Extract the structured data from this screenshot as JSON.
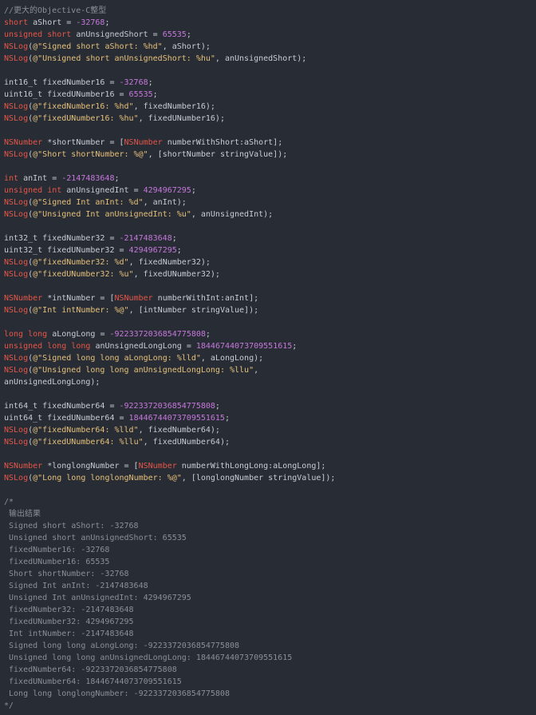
{
  "editor": {
    "colors": {
      "background": "#282c34",
      "keyword": "#e45649",
      "number": "#c678dd",
      "string": "#e5c07b",
      "comment": "#8a8f98",
      "plain": "#c8ccd4"
    },
    "lines": [
      [
        {
          "t": "comment",
          "s": "//更大的Objective-C整型"
        }
      ],
      [
        {
          "t": "keyword",
          "s": "short"
        },
        {
          "t": "plain",
          "s": " aShort = "
        },
        {
          "t": "number",
          "s": "-32768"
        },
        {
          "t": "plain",
          "s": ";"
        }
      ],
      [
        {
          "t": "keyword",
          "s": "unsigned"
        },
        {
          "t": "plain",
          "s": " "
        },
        {
          "t": "keyword",
          "s": "short"
        },
        {
          "t": "plain",
          "s": " anUnsignedShort = "
        },
        {
          "t": "number",
          "s": "65535"
        },
        {
          "t": "plain",
          "s": ";"
        }
      ],
      [
        {
          "t": "func",
          "s": "NSLog"
        },
        {
          "t": "plain",
          "s": "("
        },
        {
          "t": "string",
          "s": "@\"Signed short aShort: %hd\""
        },
        {
          "t": "plain",
          "s": ", aShort);"
        }
      ],
      [
        {
          "t": "func",
          "s": "NSLog"
        },
        {
          "t": "plain",
          "s": "("
        },
        {
          "t": "string",
          "s": "@\"Unsigned short anUnsignedShort: %hu\""
        },
        {
          "t": "plain",
          "s": ", anUnsignedShort);"
        }
      ],
      [],
      [
        {
          "t": "plain",
          "s": "int16_t fixedNumber16 = "
        },
        {
          "t": "number",
          "s": "-32768"
        },
        {
          "t": "plain",
          "s": ";"
        }
      ],
      [
        {
          "t": "plain",
          "s": "uint16_t fixedUNumber16 = "
        },
        {
          "t": "number",
          "s": "65535"
        },
        {
          "t": "plain",
          "s": ";"
        }
      ],
      [
        {
          "t": "func",
          "s": "NSLog"
        },
        {
          "t": "plain",
          "s": "("
        },
        {
          "t": "string",
          "s": "@\"fixedNumber16: %hd\""
        },
        {
          "t": "plain",
          "s": ", fixedNumber16);"
        }
      ],
      [
        {
          "t": "func",
          "s": "NSLog"
        },
        {
          "t": "plain",
          "s": "("
        },
        {
          "t": "string",
          "s": "@\"fixedUNumber16: %hu\""
        },
        {
          "t": "plain",
          "s": ", fixedUNumber16);"
        }
      ],
      [],
      [
        {
          "t": "type",
          "s": "NSNumber"
        },
        {
          "t": "plain",
          "s": " *shortNumber = ["
        },
        {
          "t": "type",
          "s": "NSNumber"
        },
        {
          "t": "plain",
          "s": " numberWithShort:aShort];"
        }
      ],
      [
        {
          "t": "func",
          "s": "NSLog"
        },
        {
          "t": "plain",
          "s": "("
        },
        {
          "t": "string",
          "s": "@\"Short shortNumber: %@\""
        },
        {
          "t": "plain",
          "s": ", [shortNumber stringValue]);"
        }
      ],
      [],
      [
        {
          "t": "keyword",
          "s": "int"
        },
        {
          "t": "plain",
          "s": " anInt = "
        },
        {
          "t": "number",
          "s": "-2147483648"
        },
        {
          "t": "plain",
          "s": ";"
        }
      ],
      [
        {
          "t": "keyword",
          "s": "unsigned"
        },
        {
          "t": "plain",
          "s": " "
        },
        {
          "t": "keyword",
          "s": "int"
        },
        {
          "t": "plain",
          "s": " anUnsignedInt = "
        },
        {
          "t": "number",
          "s": "4294967295"
        },
        {
          "t": "plain",
          "s": ";"
        }
      ],
      [
        {
          "t": "func",
          "s": "NSLog"
        },
        {
          "t": "plain",
          "s": "("
        },
        {
          "t": "string",
          "s": "@\"Signed Int anInt: %d\""
        },
        {
          "t": "plain",
          "s": ", anInt);"
        }
      ],
      [
        {
          "t": "func",
          "s": "NSLog"
        },
        {
          "t": "plain",
          "s": "("
        },
        {
          "t": "string",
          "s": "@\"Unsigned Int anUnsignedInt: %u\""
        },
        {
          "t": "plain",
          "s": ", anUnsignedInt);"
        }
      ],
      [],
      [
        {
          "t": "plain",
          "s": "int32_t fixedNumber32 = "
        },
        {
          "t": "number",
          "s": "-2147483648"
        },
        {
          "t": "plain",
          "s": ";"
        }
      ],
      [
        {
          "t": "plain",
          "s": "uint32_t fixedUNumber32 = "
        },
        {
          "t": "number",
          "s": "4294967295"
        },
        {
          "t": "plain",
          "s": ";"
        }
      ],
      [
        {
          "t": "func",
          "s": "NSLog"
        },
        {
          "t": "plain",
          "s": "("
        },
        {
          "t": "string",
          "s": "@\"fixedNumber32: %d\""
        },
        {
          "t": "plain",
          "s": ", fixedNumber32);"
        }
      ],
      [
        {
          "t": "func",
          "s": "NSLog"
        },
        {
          "t": "plain",
          "s": "("
        },
        {
          "t": "string",
          "s": "@\"fixedUNumber32: %u\""
        },
        {
          "t": "plain",
          "s": ", fixedUNumber32);"
        }
      ],
      [],
      [
        {
          "t": "type",
          "s": "NSNumber"
        },
        {
          "t": "plain",
          "s": " *intNumber = ["
        },
        {
          "t": "type",
          "s": "NSNumber"
        },
        {
          "t": "plain",
          "s": " numberWithInt:anInt];"
        }
      ],
      [
        {
          "t": "func",
          "s": "NSLog"
        },
        {
          "t": "plain",
          "s": "("
        },
        {
          "t": "string",
          "s": "@\"Int intNumber: %@\""
        },
        {
          "t": "plain",
          "s": ", [intNumber stringValue]);"
        }
      ],
      [],
      [
        {
          "t": "keyword",
          "s": "long"
        },
        {
          "t": "plain",
          "s": " "
        },
        {
          "t": "keyword",
          "s": "long"
        },
        {
          "t": "plain",
          "s": " aLongLong = "
        },
        {
          "t": "number",
          "s": "-9223372036854775808"
        },
        {
          "t": "plain",
          "s": ";"
        }
      ],
      [
        {
          "t": "keyword",
          "s": "unsigned"
        },
        {
          "t": "plain",
          "s": " "
        },
        {
          "t": "keyword",
          "s": "long"
        },
        {
          "t": "plain",
          "s": " "
        },
        {
          "t": "keyword",
          "s": "long"
        },
        {
          "t": "plain",
          "s": " anUnsignedLongLong = "
        },
        {
          "t": "number",
          "s": "18446744073709551615"
        },
        {
          "t": "plain",
          "s": ";"
        }
      ],
      [
        {
          "t": "func",
          "s": "NSLog"
        },
        {
          "t": "plain",
          "s": "("
        },
        {
          "t": "string",
          "s": "@\"Signed long long aLongLong: %lld\""
        },
        {
          "t": "plain",
          "s": ", aLongLong);"
        }
      ],
      [
        {
          "t": "func",
          "s": "NSLog"
        },
        {
          "t": "plain",
          "s": "("
        },
        {
          "t": "string",
          "s": "@\"Unsigned long long anUnsignedLongLong: %llu\""
        },
        {
          "t": "plain",
          "s": ","
        }
      ],
      [
        {
          "t": "plain",
          "s": "anUnsignedLongLong);"
        }
      ],
      [],
      [
        {
          "t": "plain",
          "s": "int64_t fixedNumber64 = "
        },
        {
          "t": "number",
          "s": "-9223372036854775808"
        },
        {
          "t": "plain",
          "s": ";"
        }
      ],
      [
        {
          "t": "plain",
          "s": "uint64_t fixedUNumber64 = "
        },
        {
          "t": "number",
          "s": "18446744073709551615"
        },
        {
          "t": "plain",
          "s": ";"
        }
      ],
      [
        {
          "t": "func",
          "s": "NSLog"
        },
        {
          "t": "plain",
          "s": "("
        },
        {
          "t": "string",
          "s": "@\"fixedNumber64: %lld\""
        },
        {
          "t": "plain",
          "s": ", fixedNumber64);"
        }
      ],
      [
        {
          "t": "func",
          "s": "NSLog"
        },
        {
          "t": "plain",
          "s": "("
        },
        {
          "t": "string",
          "s": "@\"fixedUNumber64: %llu\""
        },
        {
          "t": "plain",
          "s": ", fixedUNumber64);"
        }
      ],
      [],
      [
        {
          "t": "type",
          "s": "NSNumber"
        },
        {
          "t": "plain",
          "s": " *longlongNumber = ["
        },
        {
          "t": "type",
          "s": "NSNumber"
        },
        {
          "t": "plain",
          "s": " numberWithLongLong:aLongLong];"
        }
      ],
      [
        {
          "t": "func",
          "s": "NSLog"
        },
        {
          "t": "plain",
          "s": "("
        },
        {
          "t": "string",
          "s": "@\"Long long longlongNumber: %@\""
        },
        {
          "t": "plain",
          "s": ", [longlongNumber stringValue]);"
        }
      ],
      [],
      [
        {
          "t": "comment",
          "s": "/*"
        }
      ],
      [
        {
          "t": "comment",
          "s": " 输出结果"
        }
      ],
      [
        {
          "t": "comment",
          "s": " Signed short aShort: -32768"
        }
      ],
      [
        {
          "t": "comment",
          "s": " Unsigned short anUnsignedShort: 65535"
        }
      ],
      [
        {
          "t": "comment",
          "s": " fixedNumber16: -32768"
        }
      ],
      [
        {
          "t": "comment",
          "s": " fixedUNumber16: 65535"
        }
      ],
      [
        {
          "t": "comment",
          "s": " Short shortNumber: -32768"
        }
      ],
      [
        {
          "t": "comment",
          "s": " Signed Int anInt: -2147483648"
        }
      ],
      [
        {
          "t": "comment",
          "s": " Unsigned Int anUnsignedInt: 4294967295"
        }
      ],
      [
        {
          "t": "comment",
          "s": " fixedNumber32: -2147483648"
        }
      ],
      [
        {
          "t": "comment",
          "s": " fixedUNumber32: 4294967295"
        }
      ],
      [
        {
          "t": "comment",
          "s": " Int intNumber: -2147483648"
        }
      ],
      [
        {
          "t": "comment",
          "s": " Signed long long aLongLong: -9223372036854775808"
        }
      ],
      [
        {
          "t": "comment",
          "s": " Unsigned long long anUnsignedLongLong: 18446744073709551615"
        }
      ],
      [
        {
          "t": "comment",
          "s": " fixedNumber64: -9223372036854775808"
        }
      ],
      [
        {
          "t": "comment",
          "s": " fixedUNumber64: 18446744073709551615"
        }
      ],
      [
        {
          "t": "comment",
          "s": " Long long longlongNumber: -9223372036854775808"
        }
      ],
      [
        {
          "t": "comment",
          "s": "*/"
        }
      ]
    ]
  }
}
